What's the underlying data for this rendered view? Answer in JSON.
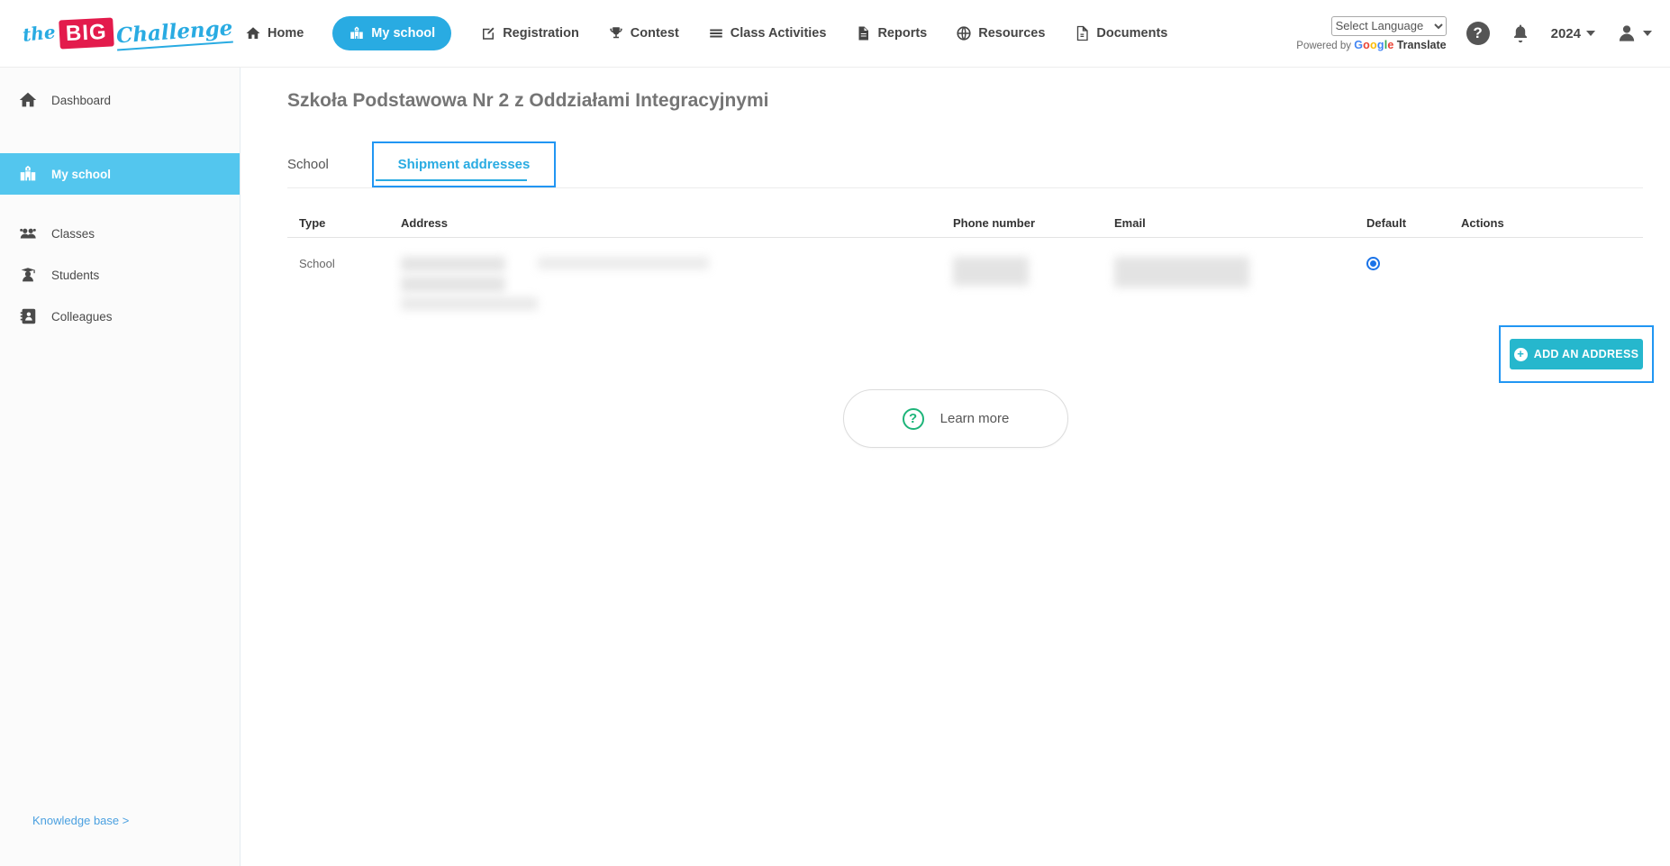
{
  "brand": {
    "the": "the",
    "big": "BIG",
    "challenge": "Challenge",
    "red": "#e31b4c",
    "blue": "#29abe2"
  },
  "topnav": {
    "items": [
      {
        "label": "Home",
        "icon": "home-icon",
        "active": false
      },
      {
        "label": "My school",
        "icon": "school-icon",
        "active": true
      },
      {
        "label": "Registration",
        "icon": "edit-icon",
        "active": false
      },
      {
        "label": "Contest",
        "icon": "trophy-icon",
        "active": false
      },
      {
        "label": "Class Activities",
        "icon": "list-icon",
        "active": false
      },
      {
        "label": "Reports",
        "icon": "report-icon",
        "active": false
      },
      {
        "label": "Resources",
        "icon": "globe-icon",
        "active": false
      },
      {
        "label": "Documents",
        "icon": "document-icon",
        "active": false
      }
    ]
  },
  "topbar_right": {
    "language_select": "Select Language",
    "powered_by": "Powered by",
    "google": "Google",
    "google_letter_colors": [
      "#4285F4",
      "#EA4335",
      "#FBBC05",
      "#4285F4",
      "#34A853",
      "#EA4335"
    ],
    "translate": "Translate",
    "year": "2024"
  },
  "sidebar": {
    "items": [
      {
        "label": "Dashboard",
        "active": false
      },
      {
        "label": "My school",
        "active": true
      },
      {
        "label": "Classes",
        "active": false
      },
      {
        "label": "Students",
        "active": false
      },
      {
        "label": "Colleagues",
        "active": false
      }
    ],
    "knowledge_base": "Knowledge base >"
  },
  "main": {
    "title": "Szkoła Podstawowa Nr 2 z Oddziałami Integracyjnymi",
    "tabs": [
      {
        "label": "School",
        "active": false
      },
      {
        "label": "Shipment addresses",
        "active": true
      }
    ],
    "table": {
      "columns": [
        "Type",
        "Address",
        "Phone number",
        "Email",
        "Default",
        "Actions"
      ],
      "rows": [
        {
          "type": "School",
          "address_redacted": true,
          "phone_redacted": true,
          "email_redacted": true,
          "default_selected": true
        }
      ]
    },
    "add_address_button": "ADD AN ADDRESS",
    "learn_more_button": "Learn more"
  },
  "colors": {
    "accent_blue": "#29abe2",
    "sidebar_active": "#53c6ee",
    "teal_button": "#26b7cd",
    "focus_outline": "#2196f3",
    "link_blue": "#4ba0e0",
    "green_help": "#1db479",
    "radio_blue": "#1a73e8"
  }
}
